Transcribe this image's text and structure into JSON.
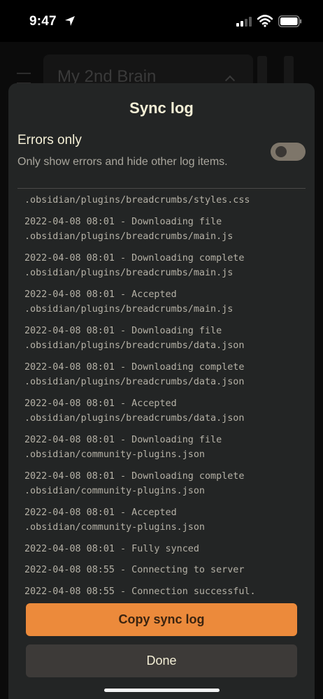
{
  "status_bar": {
    "time": "9:47"
  },
  "background": {
    "vault_title": "My 2nd Brain"
  },
  "sheet": {
    "title": "Sync log",
    "errors_only": {
      "label": "Errors only",
      "description": "Only show errors and hide other log items.",
      "enabled": false
    },
    "partial_first_line": ".obsidian/plugins/breadcrumbs/styles.css",
    "log_entries": [
      {
        "line1": "2022-04-08 08:01 - Downloading file",
        "line2": ".obsidian/plugins/breadcrumbs/main.js"
      },
      {
        "line1": "2022-04-08 08:01 - Downloading complete",
        "line2": ".obsidian/plugins/breadcrumbs/main.js"
      },
      {
        "line1": "2022-04-08 08:01 - Accepted",
        "line2": ".obsidian/plugins/breadcrumbs/main.js"
      },
      {
        "line1": "2022-04-08 08:01 - Downloading file",
        "line2": ".obsidian/plugins/breadcrumbs/data.json"
      },
      {
        "line1": "2022-04-08 08:01 - Downloading complete",
        "line2": ".obsidian/plugins/breadcrumbs/data.json"
      },
      {
        "line1": "2022-04-08 08:01 - Accepted",
        "line2": ".obsidian/plugins/breadcrumbs/data.json"
      },
      {
        "line1": "2022-04-08 08:01 - Downloading file",
        "line2": ".obsidian/community-plugins.json"
      },
      {
        "line1": "2022-04-08 08:01 - Downloading complete",
        "line2": ".obsidian/community-plugins.json"
      },
      {
        "line1": "2022-04-08 08:01 - Accepted",
        "line2": ".obsidian/community-plugins.json"
      },
      {
        "line1": "2022-04-08 08:01 - Fully synced",
        "line2": ""
      },
      {
        "line1": "2022-04-08 08:55 - Connecting to server",
        "line2": ""
      },
      {
        "line1": "2022-04-08 08:55 - Connection successful.",
        "line2": ""
      }
    ],
    "copy_button_label": "Copy sync log",
    "done_button_label": "Done"
  },
  "colors": {
    "accent": "#ec8a3b",
    "sheet_background": "#232525",
    "title_text": "#f4efd6"
  }
}
